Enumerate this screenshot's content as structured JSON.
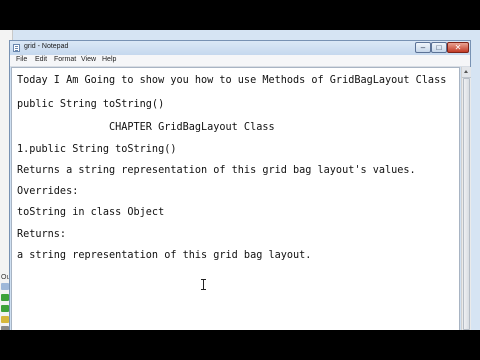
{
  "window": {
    "title": "grid - Notepad"
  },
  "titlebar_buttons": {
    "minimize": "–",
    "maximize": "□",
    "close": "✕"
  },
  "menu": [
    "File",
    "Edit",
    "Format",
    "View",
    "Help"
  ],
  "document": {
    "lines": [
      "Today I Am Going to show you how to use Methods of GridBagLayout Class",
      "public String toString()",
      "               CHAPTER GridBagLayout Class",
      "1.public String toString()",
      "Returns a string representation of this grid bag layout's values.",
      "Overrides:",
      "toString in class Object",
      "Returns:",
      "a string representation of this grid bag layout."
    ]
  },
  "left_strip": {
    "label": "Ou"
  },
  "icons": {
    "app": "notepad-icon",
    "cursor": "text-cursor-icon",
    "left_strip": [
      "output-icon",
      "run-icon",
      "run-icon",
      "debug-icon",
      "stop-icon"
    ]
  },
  "colors": {
    "desktop": "#d6e4f3",
    "close_button": "#c23a25",
    "run": "#3da23a",
    "debug": "#d6b73b",
    "stop": "#8a8a8a"
  }
}
